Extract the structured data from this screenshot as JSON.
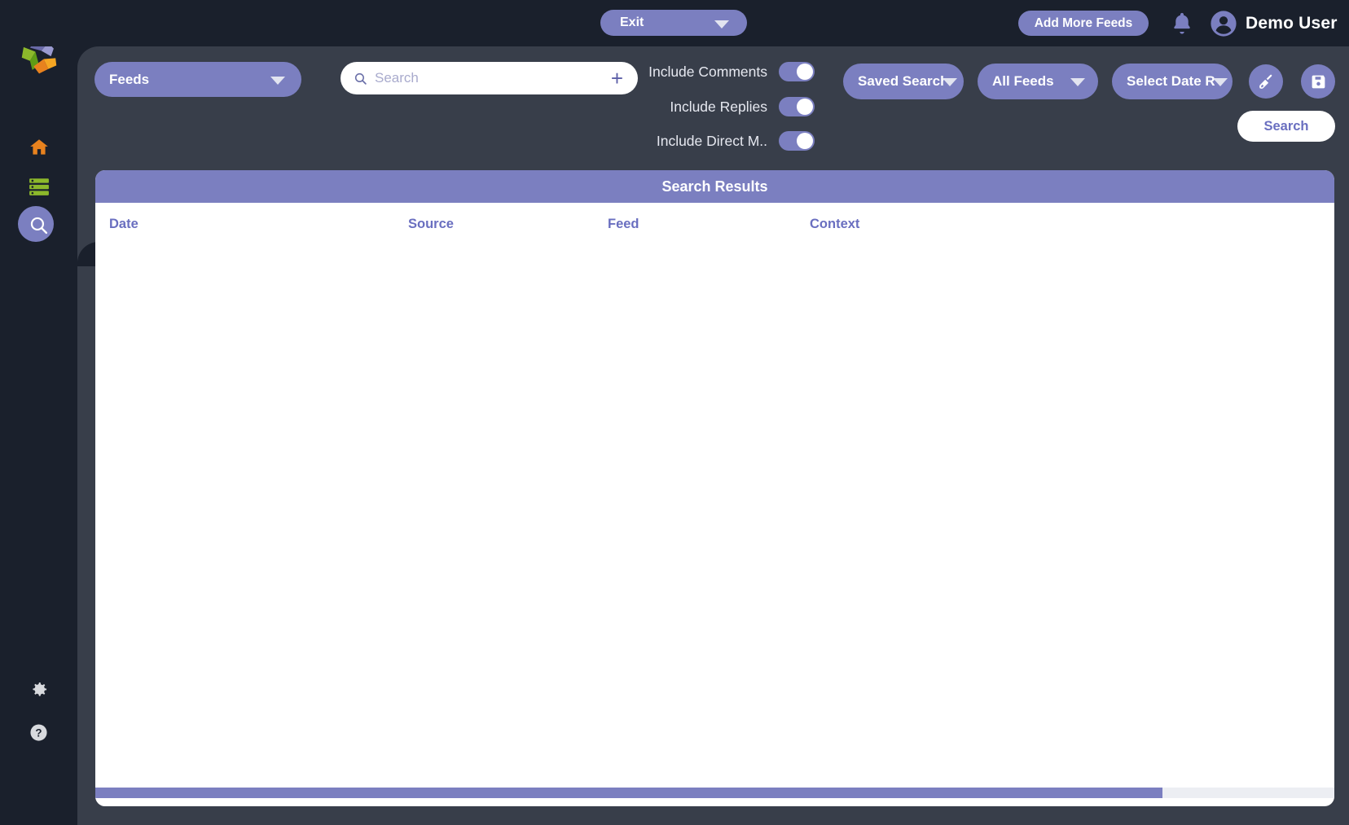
{
  "topbar": {
    "exit_label": "Exit",
    "exit_icon": "chevron-down-icon",
    "add_feeds_label": "Add More Feeds",
    "notifications_icon": "bell-icon",
    "avatar_icon": "user-avatar-icon",
    "user_name": "Demo User"
  },
  "sidebar": {
    "logo_icon": "app-logo-pinwheel-icon",
    "items": [
      {
        "name": "home",
        "icon": "home-icon",
        "active": false
      },
      {
        "name": "feeds-list",
        "icon": "list-icon",
        "active": false
      },
      {
        "name": "search",
        "icon": "search-icon",
        "active": true
      },
      {
        "name": "settings",
        "icon": "gear-icon",
        "active": false
      },
      {
        "name": "help",
        "icon": "question-mark-icon",
        "active": false
      }
    ]
  },
  "filters": {
    "category_label": "Feeds",
    "category_icon": "chevron-down-icon",
    "search": {
      "placeholder": "Search",
      "value": "",
      "leading_icon": "search-icon",
      "add_icon": "plus-icon"
    },
    "toggles": [
      {
        "label": "Include Comments",
        "on": true
      },
      {
        "label": "Include Replies",
        "on": true
      },
      {
        "label": "Include Direct M..",
        "on": true
      }
    ],
    "saved_search_label": "Saved Searches",
    "all_feeds_label": "All Feeds",
    "date_range_label": "Select Date Range",
    "clear_icon": "broom-icon",
    "save_icon": "floppy-disk-save-icon",
    "search_button_label": "Search"
  },
  "results": {
    "title": "Search Results",
    "columns": [
      "Date",
      "Source",
      "Feed",
      "Context"
    ],
    "rows": []
  },
  "colors": {
    "accent": "#7b7fc0",
    "sidebar_bg": "#1a202c",
    "panel_bg": "#383e4a",
    "card_bg": "#ffffff",
    "home_icon": "#e8821e",
    "list_icon": "#8cb82b"
  }
}
